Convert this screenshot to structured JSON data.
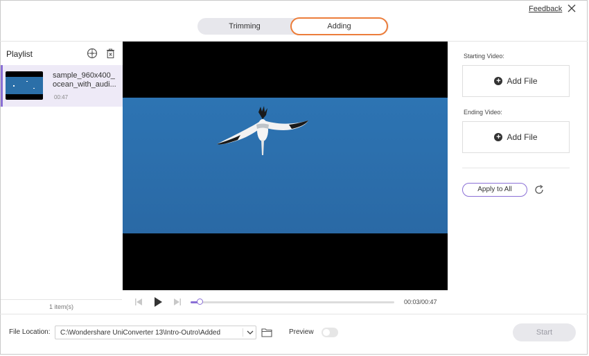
{
  "header": {
    "feedback_label": "Feedback",
    "tabs": [
      {
        "label": "Trimming",
        "active": false
      },
      {
        "label": "Adding",
        "active": true
      }
    ]
  },
  "playlist": {
    "title": "Playlist",
    "items": [
      {
        "name_line1": "sample_960x400_",
        "name_line2": "ocean_with_audi...",
        "duration": "00:47"
      }
    ],
    "count_label": "1 item(s)"
  },
  "player": {
    "current_time": "00:03",
    "total_time": "00:47",
    "time_label": "00:03/00:47",
    "progress": 0.045
  },
  "right_panel": {
    "starting_label": "Starting Video:",
    "ending_label": "Ending Video:",
    "add_file_label": "Add File",
    "apply_all_label": "Apply to All"
  },
  "footer": {
    "file_location_label": "File Location:",
    "file_location_value": "C:\\Wondershare UniConverter 13\\Intro-Outro\\Added",
    "preview_label": "Preview",
    "preview_on": false,
    "start_label": "Start"
  },
  "colors": {
    "accent": "#8a6fd6",
    "active_tab_border": "#ec7d3a",
    "sky": "#2d74b3"
  }
}
